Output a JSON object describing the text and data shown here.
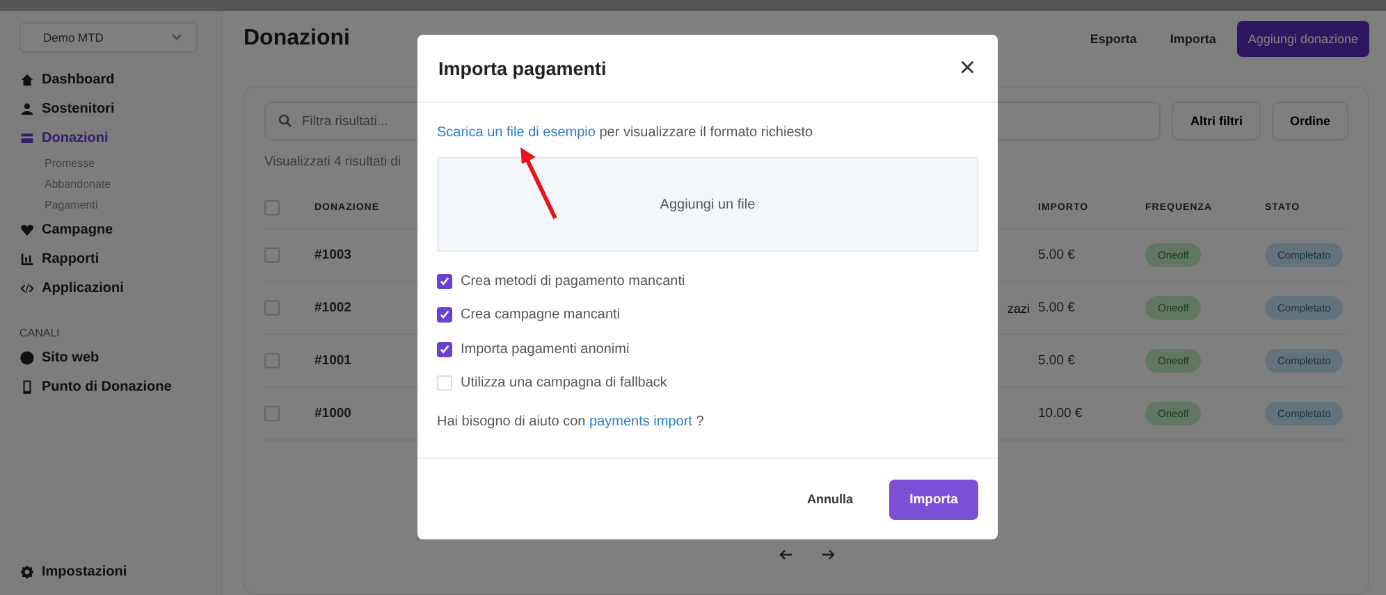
{
  "sidebar": {
    "org_selector": "Demo MTD",
    "items": [
      {
        "label": "Dashboard",
        "selected": false
      },
      {
        "label": "Sostenitori",
        "selected": false
      },
      {
        "label": "Donazioni",
        "selected": true,
        "children": [
          {
            "label": "Promesse"
          },
          {
            "label": "Abbandonate"
          },
          {
            "label": "Pagamenti"
          }
        ]
      },
      {
        "label": "Campagne",
        "selected": false
      },
      {
        "label": "Rapporti",
        "selected": false
      },
      {
        "label": "Applicazioni",
        "selected": false
      }
    ],
    "section_title": "CANALI",
    "channels": [
      {
        "label": "Sito web",
        "selected": false
      },
      {
        "label": "Punto di Donazione",
        "selected": false
      }
    ],
    "settings": {
      "label": "Impostazioni",
      "selected": false
    }
  },
  "page": {
    "title": "Donazioni",
    "actions": [
      "Esporta",
      "Importa"
    ],
    "primary_action": "Aggiungi donazione"
  },
  "filters": {
    "search_placeholder": "Filtra risultati...",
    "buttons": [
      "Altri filtri",
      "Ordine"
    ],
    "summary": "Visualizzati 4 risultati di"
  },
  "table": {
    "select_all_checked": false,
    "columns": [
      "DONAZIONE",
      "IMPORTO",
      "FREQUENZA",
      "STATO"
    ],
    "rows": [
      {
        "checked": false,
        "donazione": "#1003",
        "column_3": "",
        "importo": "5.00 €",
        "frequenza": "Oneoff",
        "stato": "Completato"
      },
      {
        "checked": false,
        "donazione": "#1002",
        "column_3": "zazi",
        "importo": "5.00 €",
        "frequenza": "Oneoff",
        "stato": "Completato"
      },
      {
        "checked": false,
        "donazione": "#1001",
        "column_3": "",
        "importo": "5.00 €",
        "frequenza": "Oneoff",
        "stato": "Completato"
      },
      {
        "checked": false,
        "donazione": "#1000",
        "column_3": "",
        "importo": "10.00 €",
        "frequenza": "Oneoff",
        "stato": "Completato"
      }
    ]
  },
  "modal": {
    "title": "Importa pagamenti",
    "close": "×",
    "download_link": "Scarica un file di esempio",
    "download_text": "per visualizzare il formato richiesto",
    "dropzone": "Aggiungi un file",
    "options": [
      {
        "label": "Crea metodi di pagamento mancanti",
        "checked": true
      },
      {
        "label": "Crea campagne mancanti",
        "checked": true
      },
      {
        "label": "Importa pagamenti anonimi",
        "checked": true
      },
      {
        "label": "Utilizza una campagna di fallback",
        "checked": false
      }
    ],
    "help_text": "Hai bisogno di aiuto con",
    "help_link": "payments import",
    "help_suffix": "?",
    "buttons": {
      "cancel": "Annulla",
      "submit": "Importa"
    }
  }
}
